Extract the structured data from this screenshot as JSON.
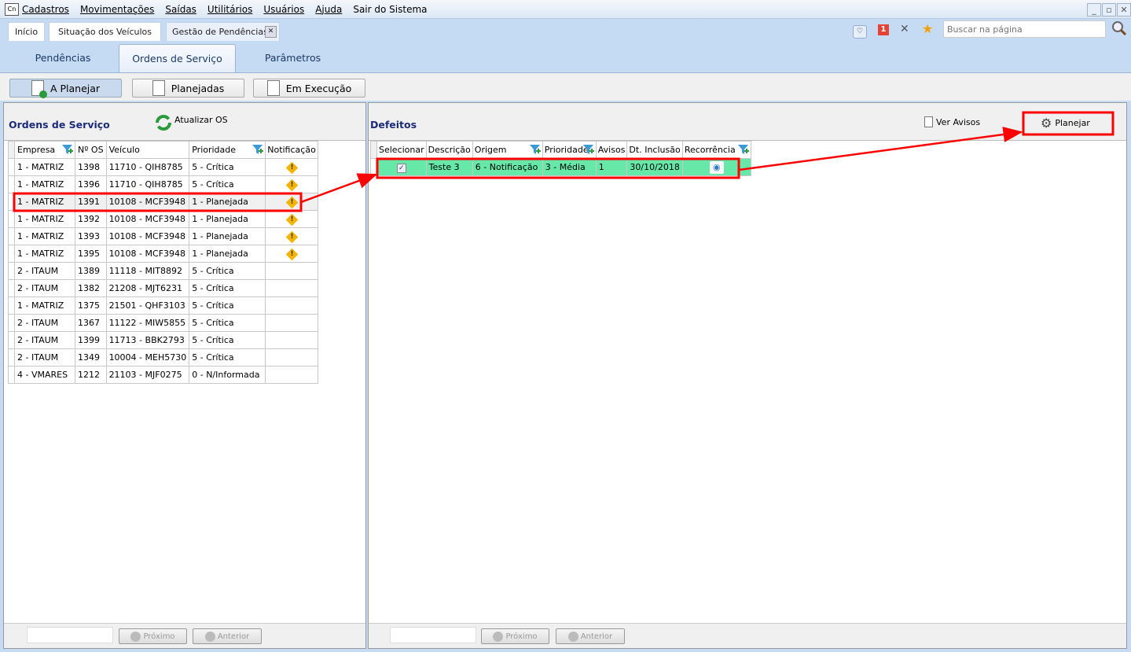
{
  "menu": {
    "items": [
      "Cadastros",
      "Movimentações",
      "Saídas",
      "Utilitários",
      "Usuários",
      "Ajuda",
      "Sair do Sistema"
    ]
  },
  "doc_tabs": [
    "Início",
    "Situação dos Veículos",
    "Gestão de Pendências"
  ],
  "search": {
    "placeholder": "Buscar na página",
    "value": ""
  },
  "notification_count": "1",
  "sub_tabs": [
    "Pendências",
    "Ordens de Serviço",
    "Parâmetros"
  ],
  "active_sub_tab": "Ordens de Serviço",
  "toolbar": [
    "A Planejar",
    "Planejadas",
    "Em Execução"
  ],
  "left": {
    "title": "Ordens de Serviço",
    "refresh_label": "Atualizar OS",
    "columns": [
      "Empresa",
      "Nº OS",
      "Veículo",
      "Prioridade",
      "Notificação"
    ],
    "rows": [
      [
        "1 - MATRIZ",
        "1398",
        "11710 - QIH8785",
        "5 - Crítica",
        true
      ],
      [
        "1 - MATRIZ",
        "1396",
        "11710 - QIH8785",
        "5 - Crítica",
        true
      ],
      [
        "1 - MATRIZ",
        "1391",
        "10108 - MCF3948",
        "1 - Planejada",
        true
      ],
      [
        "1 - MATRIZ",
        "1392",
        "10108 - MCF3948",
        "1 - Planejada",
        true
      ],
      [
        "1 - MATRIZ",
        "1393",
        "10108 - MCF3948",
        "1 - Planejada",
        true
      ],
      [
        "1 - MATRIZ",
        "1395",
        "10108 - MCF3948",
        "1 - Planejada",
        true
      ],
      [
        "2 - ITAUM",
        "1389",
        "11118 - MIT8892",
        "5 - Crítica",
        false
      ],
      [
        "2 - ITAUM",
        "1382",
        "21208 - MJT6231",
        "5 - Crítica",
        false
      ],
      [
        "1 - MATRIZ",
        "1375",
        "21501 - QHF3103",
        "5 - Crítica",
        false
      ],
      [
        "2 - ITAUM",
        "1367",
        "11122 - MIW5855",
        "5 - Crítica",
        false
      ],
      [
        "2 - ITAUM",
        "1399",
        "11713 - BBK2793",
        "5 - Crítica",
        false
      ],
      [
        "2 - ITAUM",
        "1349",
        "10004 - MEH5730",
        "5 - Crítica",
        false
      ],
      [
        "4 - VMARES",
        "1212",
        "21103 - MJF0275",
        "0 - N/Informada",
        false
      ]
    ],
    "selected_row": 2,
    "next_label": "Próximo",
    "prev_label": "Anterior"
  },
  "right": {
    "title": "Defeitos",
    "ver_avisos_label": "Ver Avisos",
    "planejar_label": "Planejar",
    "columns": [
      "Selecionar",
      "Descrição",
      "Origem",
      "Prioridade",
      "Avisos",
      "Dt. Inclusão",
      "Recorrência"
    ],
    "rows": [
      {
        "selected": true,
        "descricao": "Teste 3",
        "origem": "6 - Notificação",
        "prioridade": "3 - Média",
        "avisos": "1",
        "dt_inclusao": "30/10/2018"
      }
    ],
    "row_color": "#66e8a8",
    "next_label": "Próximo",
    "prev_label": "Anterior"
  },
  "annotation_color": "#ff0000"
}
